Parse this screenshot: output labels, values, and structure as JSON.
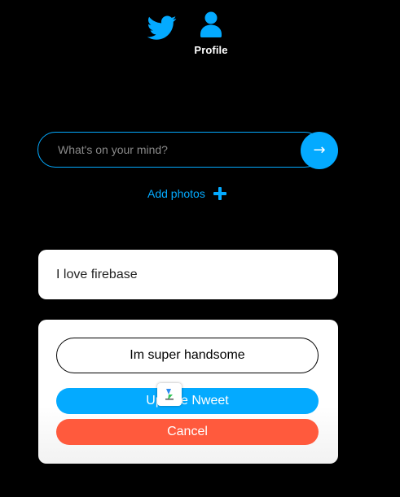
{
  "nav": {
    "home_icon": "twitter-bird-icon",
    "profile_icon": "user-icon",
    "profile_label": "Profile",
    "accent_color": "#04aaff"
  },
  "composer": {
    "placeholder": "What's on your mind?",
    "value": "",
    "submit_icon": "arrow-right-icon",
    "submit_glyph": "→",
    "add_photos_label": "Add photos",
    "add_photos_icon": "plus-icon"
  },
  "nweets": [
    {
      "text": "I love firebase"
    }
  ],
  "edit": {
    "value": "Im super handsome",
    "update_label": "Update Nweet",
    "cancel_label": "Cancel",
    "update_color": "#04aaff",
    "cancel_color": "#ff5a3d",
    "overlay_icon": "app-badge-icon"
  }
}
